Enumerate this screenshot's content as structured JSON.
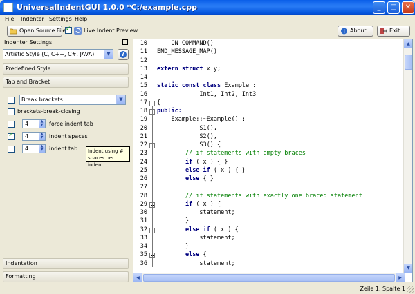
{
  "window": {
    "title": "UniversalIndentGUI 1.0.0 *C:/example.cpp"
  },
  "menu": [
    "File",
    "Indenter",
    "Settings",
    "Help"
  ],
  "toolbar": {
    "open_label": "Open Source File",
    "live_preview_label": "Live Indent Preview",
    "live_preview_checked": true,
    "about_label": "About",
    "exit_label": "Exit"
  },
  "panel": {
    "title": "Indenter Settings",
    "indenter_selected": "Artistic Style (C, C++, C#, JAVA)",
    "sections": {
      "predefined": "Predefined Style",
      "tab_bracket": "Tab and Bracket",
      "indentation": "Indentation",
      "formatting": "Formatting"
    },
    "options": [
      {
        "type": "combo",
        "value": "Break brackets",
        "checked": false
      },
      {
        "type": "check",
        "label": "brackets-break-closing",
        "checked": false
      },
      {
        "type": "spin",
        "value": "4",
        "label": "force indent tab",
        "checked": false
      },
      {
        "type": "spin",
        "value": "4",
        "label": "indent spaces",
        "checked": true
      },
      {
        "type": "spin",
        "value": "4",
        "label": "indent tab",
        "checked": false
      }
    ],
    "tooltip": "Indent using # spaces per indent"
  },
  "editor": {
    "lines": [
      {
        "n": "10",
        "code": [
          [
            "",
            "    ON_COMMAND()"
          ]
        ]
      },
      {
        "n": "11",
        "code": [
          [
            "",
            "END_MESSAGE_MAP()"
          ]
        ]
      },
      {
        "n": "12",
        "code": []
      },
      {
        "n": "13",
        "code": [
          [
            "kw",
            "extern struct"
          ],
          [
            "",
            " x y;"
          ]
        ]
      },
      {
        "n": "14",
        "code": []
      },
      {
        "n": "15",
        "code": [
          [
            "kw",
            "static const class"
          ],
          [
            "",
            " Example :"
          ]
        ]
      },
      {
        "n": "16",
        "code": [
          [
            "",
            "            Int1, Int2, Int3"
          ]
        ]
      },
      {
        "n": "17",
        "fold": true,
        "code": [
          [
            "",
            "{"
          ]
        ]
      },
      {
        "n": "18",
        "fold": true,
        "code": [
          [
            "kw",
            "public:"
          ]
        ]
      },
      {
        "n": "19",
        "code": [
          [
            "",
            "    Example::~Example() :"
          ]
        ]
      },
      {
        "n": "20",
        "code": [
          [
            "",
            "            S1(),"
          ]
        ]
      },
      {
        "n": "21",
        "code": [
          [
            "",
            "            S2(),"
          ]
        ]
      },
      {
        "n": "22",
        "fold": true,
        "code": [
          [
            "",
            "            S3() {"
          ]
        ]
      },
      {
        "n": "23",
        "code": [
          [
            "cm",
            "        // if statements with empty braces"
          ]
        ]
      },
      {
        "n": "24",
        "code": [
          [
            "",
            "        "
          ],
          [
            "kw",
            "if"
          ],
          [
            "",
            " ( x ) { }"
          ]
        ]
      },
      {
        "n": "25",
        "code": [
          [
            "",
            "        "
          ],
          [
            "kw",
            "else if"
          ],
          [
            "",
            " ( x ) { }"
          ]
        ]
      },
      {
        "n": "26",
        "code": [
          [
            "",
            "        "
          ],
          [
            "kw",
            "else"
          ],
          [
            "",
            " { }"
          ]
        ]
      },
      {
        "n": "27",
        "code": []
      },
      {
        "n": "28",
        "code": [
          [
            "cm",
            "        // if statements with exactly one braced statement"
          ]
        ]
      },
      {
        "n": "29",
        "fold": true,
        "code": [
          [
            "",
            "        "
          ],
          [
            "kw",
            "if"
          ],
          [
            "",
            " ( x ) {"
          ]
        ]
      },
      {
        "n": "30",
        "code": [
          [
            "",
            "            statement;"
          ]
        ]
      },
      {
        "n": "31",
        "code": [
          [
            "",
            "        }"
          ]
        ]
      },
      {
        "n": "32",
        "fold": true,
        "code": [
          [
            "",
            "        "
          ],
          [
            "kw",
            "else if"
          ],
          [
            "",
            " ( x ) {"
          ]
        ]
      },
      {
        "n": "33",
        "code": [
          [
            "",
            "            statement;"
          ]
        ]
      },
      {
        "n": "34",
        "code": [
          [
            "",
            "        }"
          ]
        ]
      },
      {
        "n": "35",
        "fold": true,
        "code": [
          [
            "",
            "        "
          ],
          [
            "kw",
            "else"
          ],
          [
            "",
            " {"
          ]
        ]
      },
      {
        "n": "36",
        "code": [
          [
            "",
            "            statement;"
          ]
        ]
      }
    ]
  },
  "status": {
    "position": "Zeile 1, Spalte 1"
  },
  "icons": {
    "open": "folder-open-icon",
    "refresh": "refresh-icon",
    "about": "info-icon",
    "exit": "exit-icon",
    "help": "help-icon"
  }
}
